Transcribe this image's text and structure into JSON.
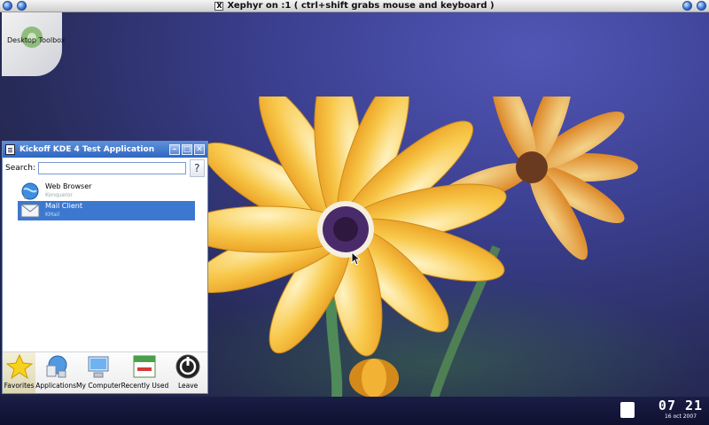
{
  "xephyr": {
    "title": "Xephyr on :1 ( ctrl+shift grabs mouse and keyboard )",
    "logo": "X"
  },
  "desktop": {
    "toolbox_label": "Desktop Toolbox"
  },
  "kickoff": {
    "title": "Kickoff KDE 4 Test Application",
    "controls": {
      "minimize": "–",
      "maximize": "□",
      "close": "✕"
    },
    "search": {
      "label": "Search:",
      "value": "",
      "placeholder": ""
    },
    "help_label": "?",
    "items": [
      {
        "name": "Web Browser",
        "sub": "Konqueror",
        "icon": "globe-icon",
        "selected": false
      },
      {
        "name": "Mail Client",
        "sub": "KMail",
        "icon": "mail-icon",
        "selected": true
      }
    ],
    "tabs": [
      {
        "label": "Favorites",
        "icon": "star-icon",
        "active": true
      },
      {
        "label": "Applications",
        "icon": "applications-icon",
        "active": false
      },
      {
        "label": "My Computer",
        "icon": "computer-icon",
        "active": false
      },
      {
        "label": "Recently Used",
        "icon": "calendar-icon",
        "active": false
      },
      {
        "label": "Leave",
        "icon": "power-icon",
        "active": false
      }
    ]
  },
  "taskbar": {
    "time": "07 21",
    "date": "16 oct 2007"
  },
  "colors": {
    "selection": "#3c78d0",
    "titlebar": "#2f66c1",
    "taskbar": "#13163a"
  }
}
